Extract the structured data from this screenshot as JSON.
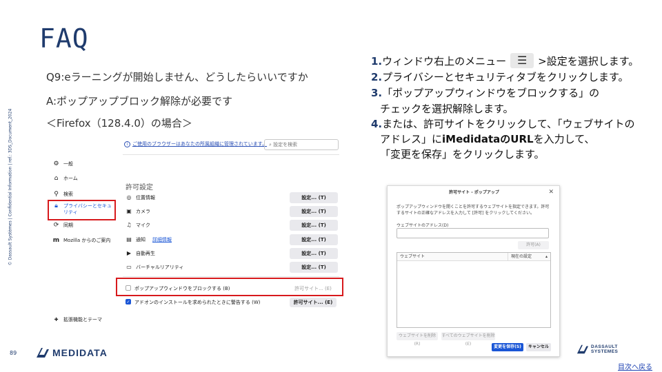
{
  "slide": {
    "title": "FAQ",
    "side_note": "© Dassault Systèmes | Confidential Information | ref.: 3DS_Document_2024",
    "page_number": "89",
    "back_link": "目次へ戻る",
    "medidata_logo_text": "MEDIDATA",
    "ds_logo_line1": "DASSAULT",
    "ds_logo_line2": "SYSTEMES"
  },
  "faq": {
    "question": "Q9:eラーニングが開始しません、どうしたらいいですか",
    "answer": "A:ポップアップブロック解除が必要です",
    "case": "＜Firefox（128.4.0）の場合＞"
  },
  "instructions": {
    "step1_num": "1.",
    "step1_a": "ウィンドウ右上のメニュー",
    "step1_b": ">設定を選択します。",
    "step2_num": "2.",
    "step2": "プライバシーとセキュリティタブをクリックします。",
    "step3_num": "3.",
    "step3_a": "「ポップアップウィンドウをブロックする」の",
    "step3_b": "チェックを選択解除します。",
    "step4_num": "4.",
    "step4_a": "または、許可サイトをクリックして、「ウェブサイトの",
    "step4_b_pre": "アドレス」に",
    "step4_b_bold": "iMedidataのURL",
    "step4_b_post": "を入力して、",
    "step4_c": "「変更を保存」をクリックします。"
  },
  "firefox": {
    "notice": "ご使用のブラウザーはあなたの所属組織に管理されています。",
    "search_placeholder": "設定を検索",
    "nav": [
      {
        "label": "一般",
        "icon": "gear-icon"
      },
      {
        "label": "ホーム",
        "icon": "home-icon"
      },
      {
        "label": "検索",
        "icon": "search-icon"
      },
      {
        "label": "プライバシーとセキュリティ",
        "icon": "lock-icon"
      },
      {
        "label": "同期",
        "icon": "sync-icon"
      },
      {
        "label": "Mozilla からのご案内",
        "icon": "mozilla-icon"
      }
    ],
    "extensions_label": "拡張機能とテーマ",
    "section_title": "許可設定",
    "permissions": [
      {
        "label": "位置情報",
        "icon": "location-icon",
        "button": "設定... (T)"
      },
      {
        "label": "カメラ",
        "icon": "camera-icon",
        "button": "設定... (T)"
      },
      {
        "label": "マイク",
        "icon": "microphone-icon",
        "button": "設定... (T)"
      },
      {
        "label": "通知",
        "icon": "notification-icon",
        "button": "設定... (T)",
        "link": "詳細情報"
      },
      {
        "label": "自動再生",
        "icon": "autoplay-icon",
        "button": "設定... (T)"
      },
      {
        "label": "バーチャルリアリティ",
        "icon": "vr-icon",
        "button": "設定... (T)"
      }
    ],
    "popup_block": {
      "label": "ポップアップウィンドウをブロックする (B)",
      "checked": false,
      "button": "許可サイト... (E)"
    },
    "addon_warn": {
      "label": "アドオンのインストールを求められたときに警告する (W)",
      "checked": true,
      "button": "許可サイト... (E)"
    }
  },
  "dialog": {
    "title": "許可サイト - ポップアップ",
    "description": "ポップアップウィンドウを開くことを許可するウェブサイトを指定できます。許可するサイトの正確なアドレスを入力して [許可] をクリックしてください。",
    "address_label": "ウェブサイトのアドレス(D)",
    "address_value": "",
    "allow_button": "許可(A)",
    "col_website": "ウェブサイト",
    "col_status": "現在の設定",
    "remove_button": "ウェブサイトを削除(R)",
    "remove_all_button": "すべてのウェブサイトを削除(E)",
    "save_button": "変更を保存(S)",
    "cancel_button": "キャンセル"
  },
  "colors": {
    "title_blue": "#1f3b6d",
    "highlight_red": "#d7191c",
    "firefox_blue": "#1a56d6"
  }
}
